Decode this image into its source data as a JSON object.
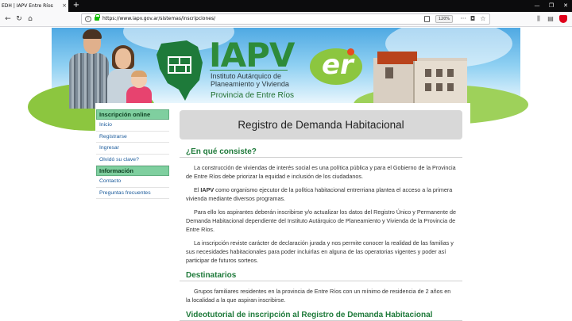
{
  "browser": {
    "tab_title": "EDH | IAPV Entre Ríos",
    "tab_close": "×",
    "new_tab": "+",
    "url": "https://www.iapv.gov.ar/sistemas/inscripciones/",
    "zoom": "120%",
    "nav": {
      "back": "←",
      "forward": "→",
      "reload": "↻",
      "home": "⌂"
    },
    "url_actions": {
      "more": "···",
      "pocket": "◘",
      "bookmark": "☆"
    },
    "window_controls": {
      "minimize": "—",
      "restore": "❐",
      "close": "✕"
    },
    "toolbar_icons": {
      "library": "⫼",
      "sidebar": "▤",
      "menu": "☰"
    }
  },
  "header": {
    "logo_text": "IAPV",
    "logo_line1": "Instituto Autárquico de",
    "logo_line2": "Planeamiento y Vivienda",
    "logo_line3": "Provincia de Entre Ríos",
    "er_text": "er"
  },
  "sidebar": {
    "sections": [
      {
        "heading": "Inscripción online",
        "items": [
          "Inicio",
          "Registrarse",
          "Ingresar",
          "Olvidó su clave?"
        ]
      },
      {
        "heading": "Información",
        "items": [
          "Contacto",
          "Preguntas frecuentes"
        ]
      }
    ]
  },
  "main": {
    "title": "Registro de Demanda Habitacional",
    "section1_heading": "¿En qué consiste?",
    "p1": "La construcción de viviendas de interés social es una política pública y para el Gobierno de la Provincia de Entre Ríos debe priorizar la equidad e inclusión de los ciudadanos.",
    "p2_pre": "El ",
    "p2_bold": "IAPV",
    "p2_post": " como organismo ejecutor de la política habitacional entrerriana plantea el acceso a la primera vivienda mediante diversos programas.",
    "p3": "Para ello los aspirantes deberán inscribirse y/o actualizar los datos del Registro Único y Permanente de Demanda Habitacional dependiente del Instituto Autárquico de Planeamiento y Vivienda de la Provincia de Entre Ríos.",
    "p4": "La inscripción reviste carácter de declaración jurada y nos permite conocer la realidad de las familias y sus necesidades habitacionales para poder incluirlas en alguna de las operatorias vigentes y poder así participar de futuros sorteos.",
    "section2_heading": "Destinatarios",
    "p5": "Grupos familiares residentes en la provincia de Entre Ríos con un mínimo de residencia de 2 años en la localidad a la que aspiran inscribirse.",
    "section3_heading": "Videotutorial de inscripción al Registro de Demanda Habitacional"
  }
}
